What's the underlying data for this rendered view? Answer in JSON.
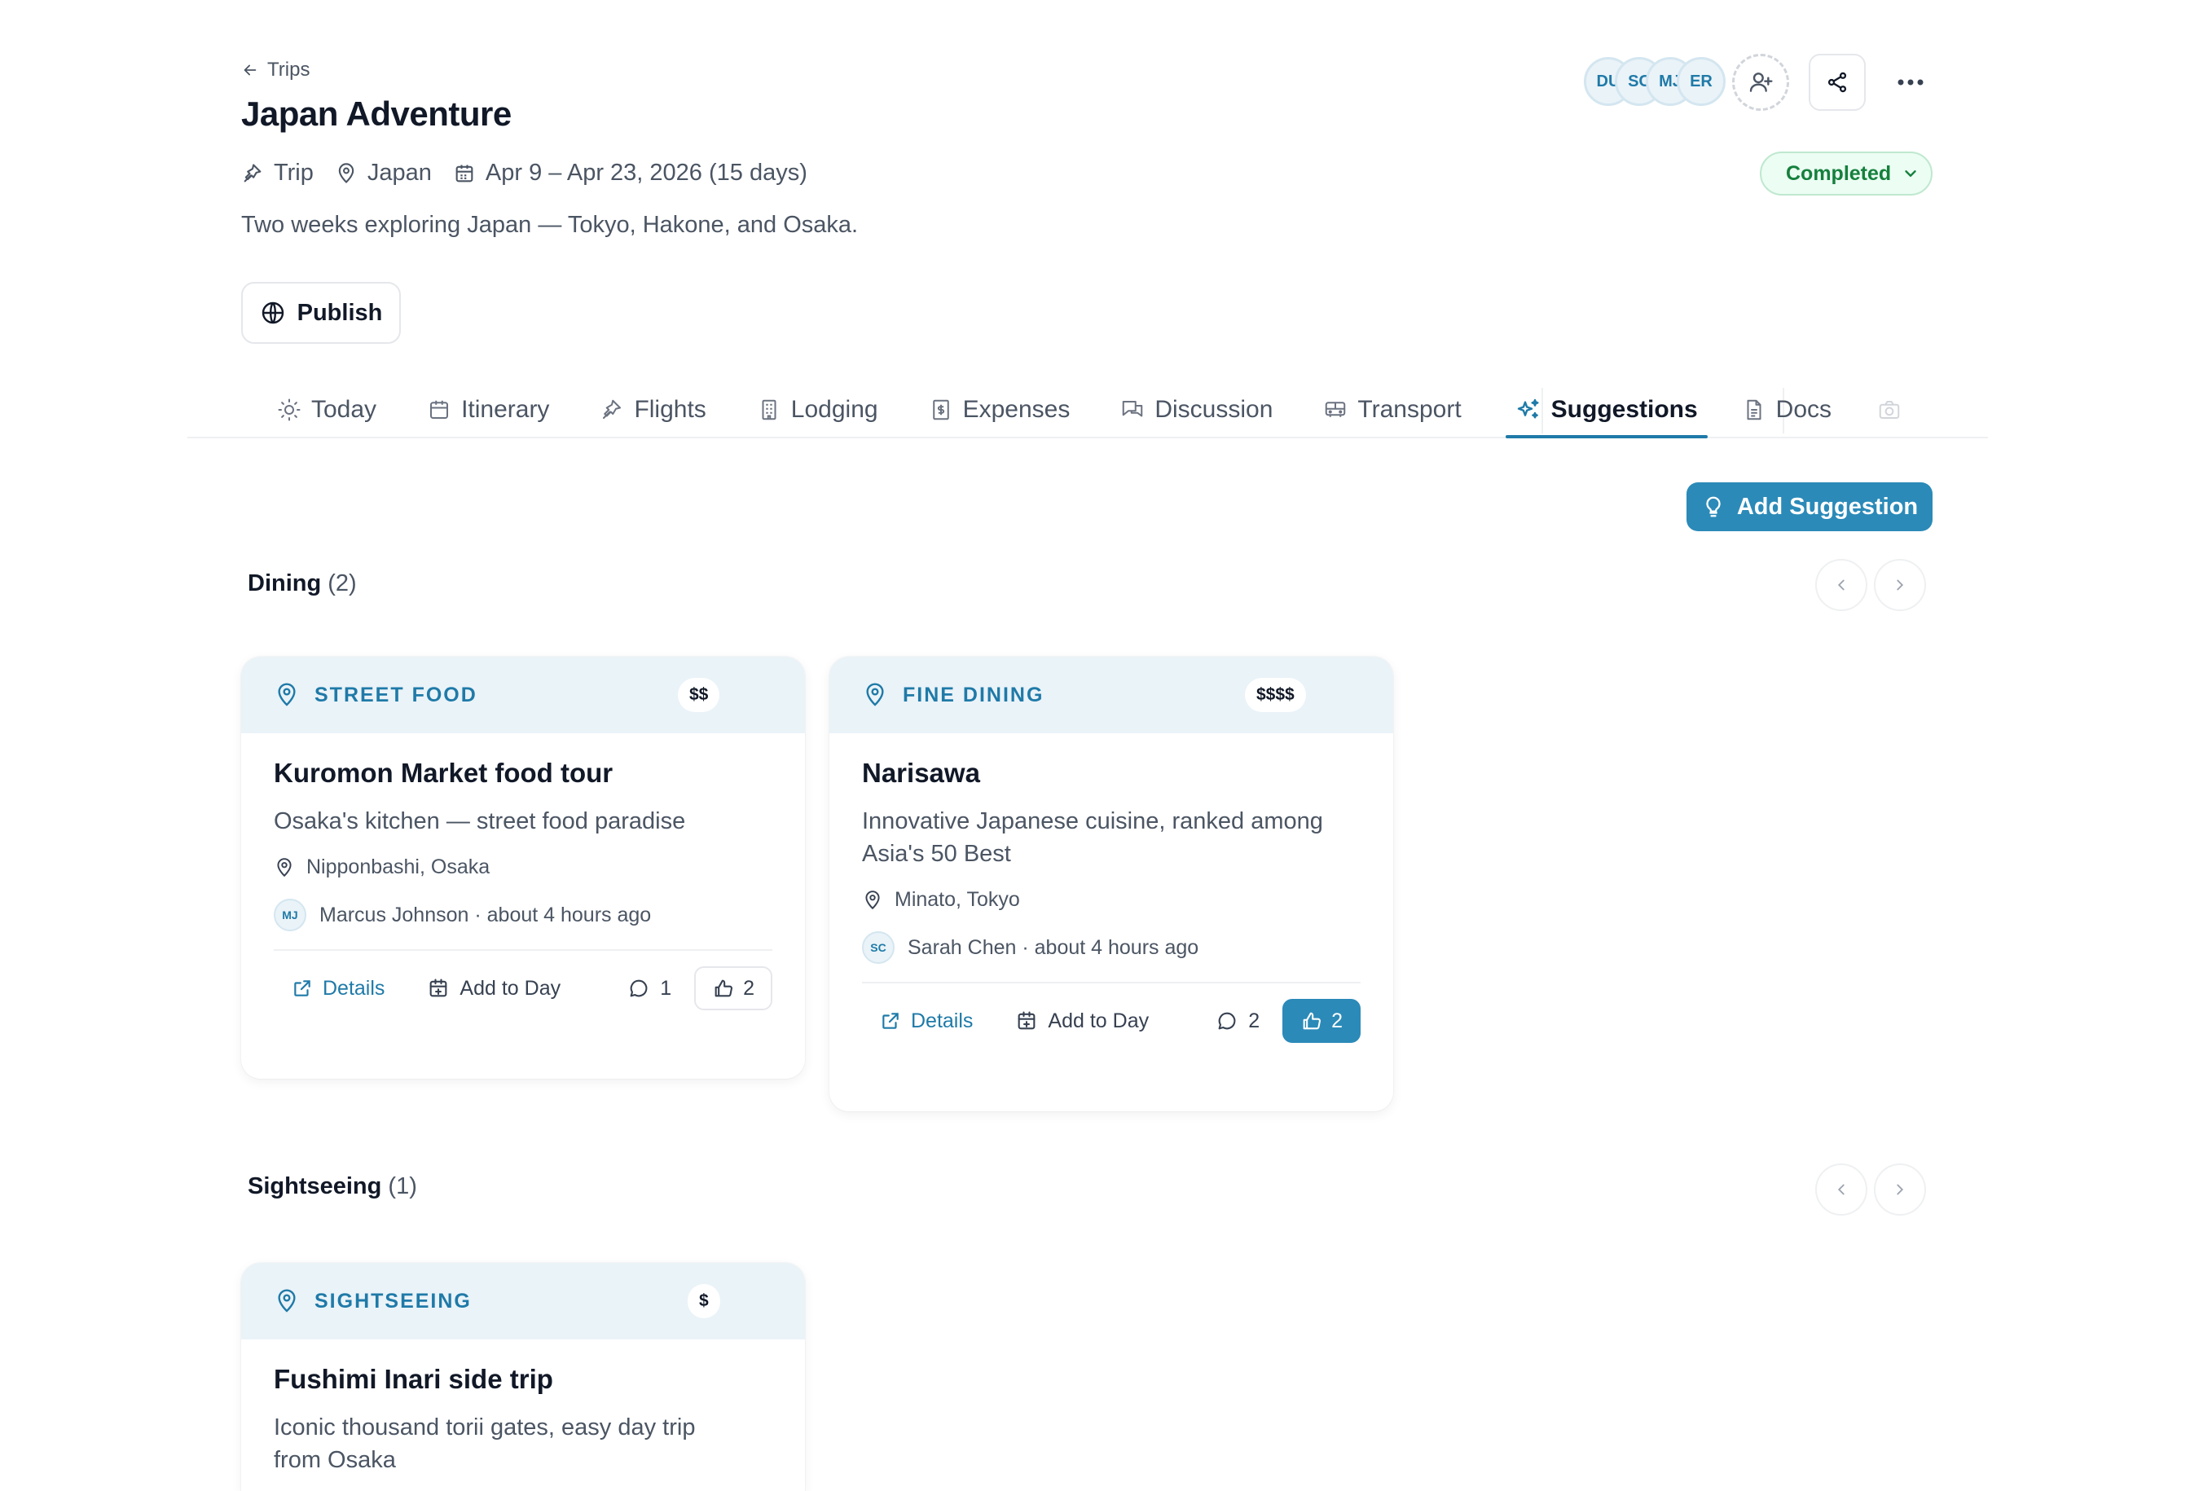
{
  "breadcrumb": {
    "label": "Trips"
  },
  "trip": {
    "title": "Japan Adventure",
    "type": "Trip",
    "location": "Japan",
    "dates": "Apr 9 – Apr 23, 2026 (15 days)",
    "description": "Two weeks exploring Japan — Tokyo, Hakone, and Osaka.",
    "status": "Completed"
  },
  "actions": {
    "publish": "Publish",
    "add_suggestion": "Add Suggestion"
  },
  "members": [
    "DU",
    "SC",
    "MJ",
    "ER"
  ],
  "tabs": [
    {
      "label": "Today",
      "icon": "sun-icon"
    },
    {
      "label": "Itinerary",
      "icon": "calendar-icon"
    },
    {
      "label": "Flights",
      "icon": "plane-icon"
    },
    {
      "label": "Lodging",
      "icon": "building-icon"
    },
    {
      "label": "Expenses",
      "icon": "receipt-icon"
    },
    {
      "label": "Discussion",
      "icon": "chat-icon"
    },
    {
      "label": "Transport",
      "icon": "bus-icon"
    },
    {
      "label": "Suggestions",
      "icon": "sparkles-icon",
      "active": true
    },
    {
      "label": "Docs",
      "icon": "document-icon"
    }
  ],
  "sections": [
    {
      "name": "Dining",
      "count": "(2)",
      "cards": [
        {
          "category": "STREET FOOD",
          "price": "$$",
          "title": "Kuromon Market food tour",
          "subtitle": "Osaka's kitchen — street food paradise",
          "location": "Nipponbashi, Osaka",
          "author_initials": "MJ",
          "author": "Marcus Johnson · about 4 hours ago",
          "details": "Details",
          "add_to_day": "Add to Day",
          "comments": "1",
          "votes": "2",
          "voted": false
        },
        {
          "category": "FINE DINING",
          "price": "$$$$",
          "title": "Narisawa",
          "subtitle": "Innovative Japanese cuisine, ranked among Asia's 50 Best",
          "location": "Minato, Tokyo",
          "author_initials": "SC",
          "author": "Sarah Chen · about 4 hours ago",
          "details": "Details",
          "add_to_day": "Add to Day",
          "comments": "2",
          "votes": "2",
          "voted": true
        }
      ]
    },
    {
      "name": "Sightseeing",
      "count": "(1)",
      "cards": [
        {
          "category": "SIGHTSEEING",
          "price": "$",
          "title": "Fushimi Inari side trip",
          "subtitle": "Iconic thousand torii gates, easy day trip from Osaka"
        }
      ]
    }
  ]
}
